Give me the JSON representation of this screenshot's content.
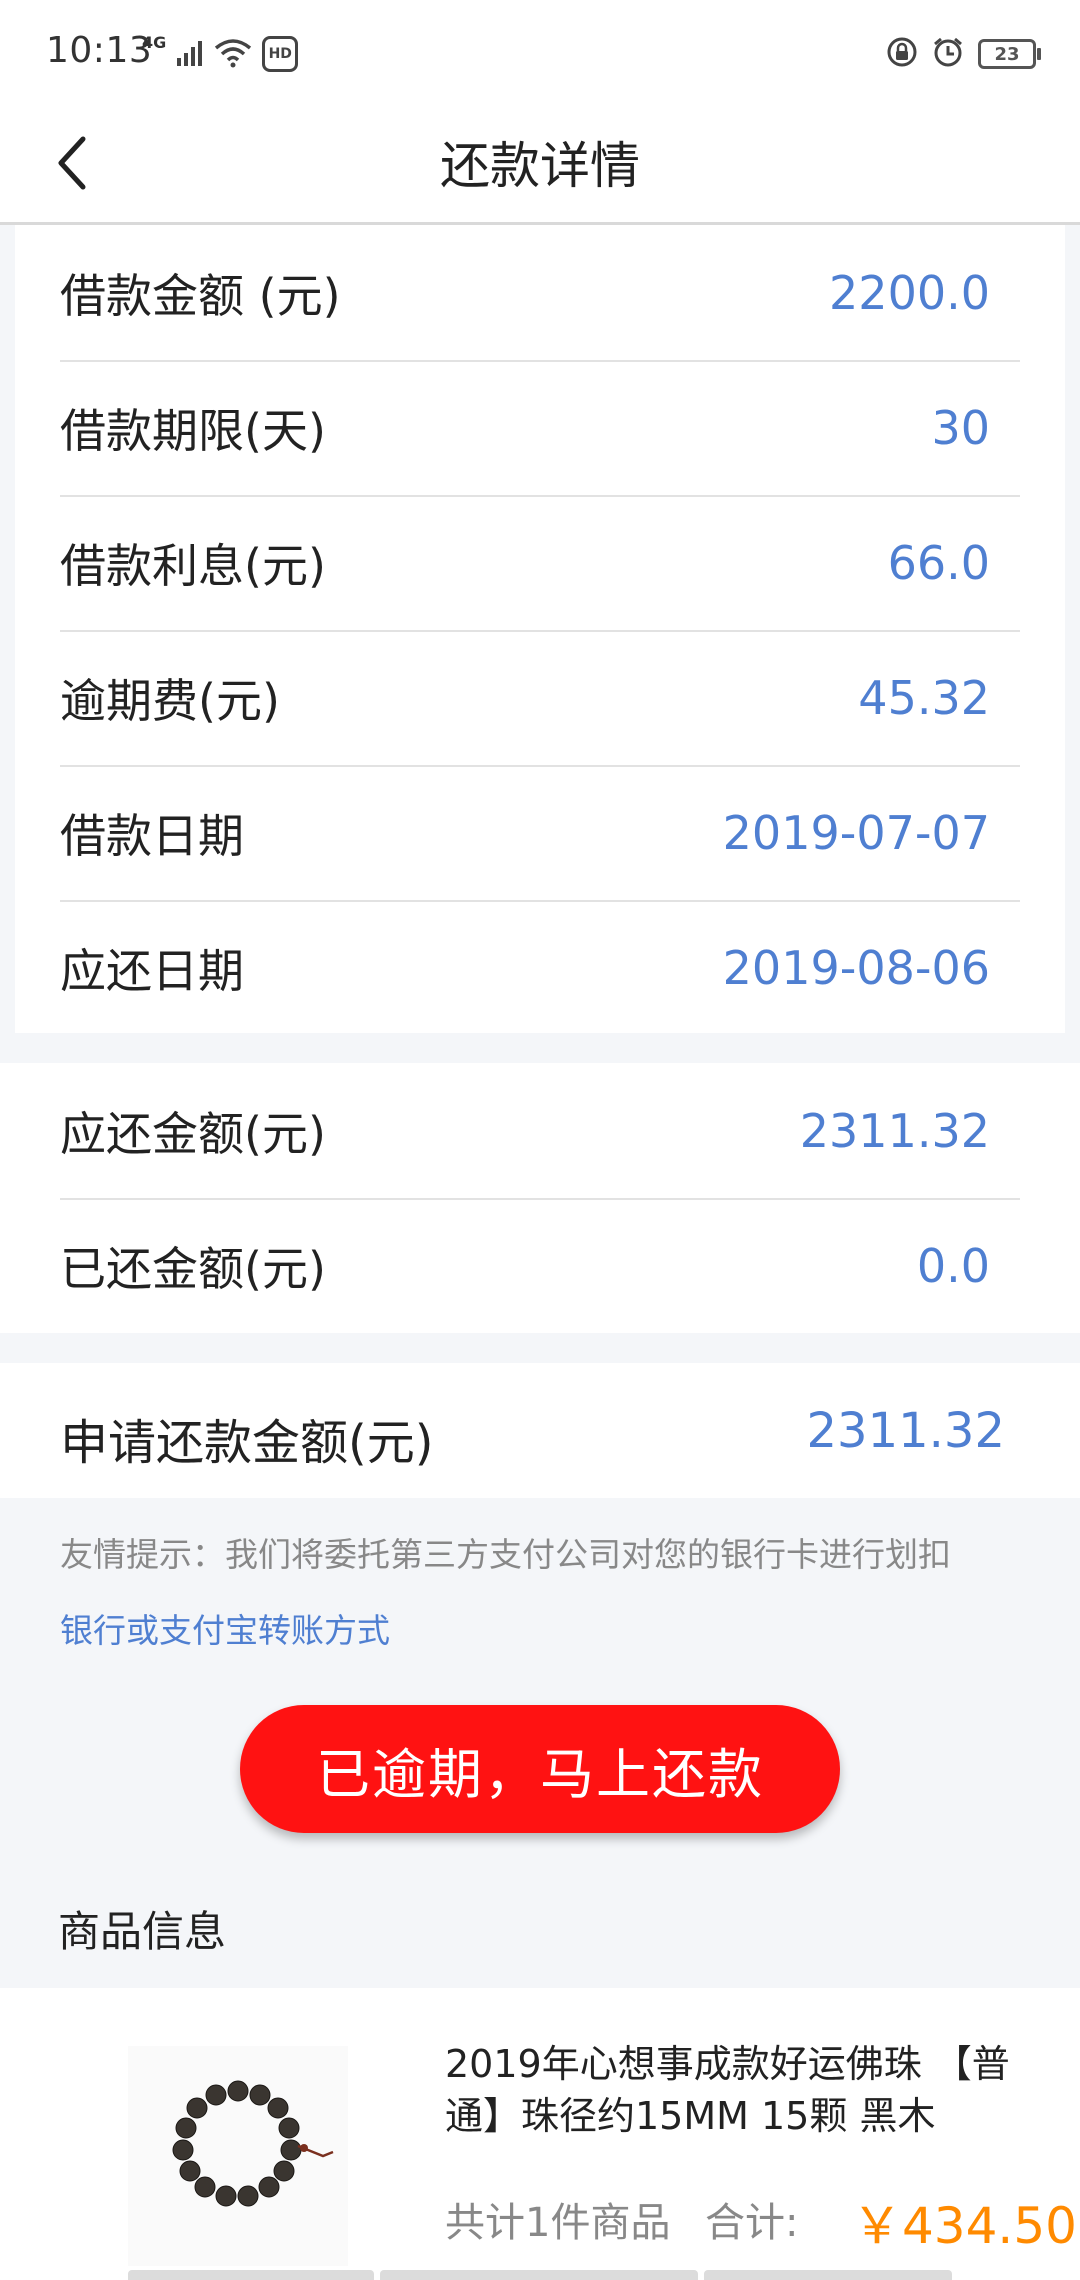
{
  "status_bar": {
    "time": "10:13",
    "network": "4G",
    "hd": "HD",
    "battery": "23"
  },
  "header": {
    "title": "还款详情"
  },
  "loan_details": [
    {
      "label": "借款金额 (元)",
      "value": "2200.0"
    },
    {
      "label": "借款期限(天)",
      "value": "30"
    },
    {
      "label": "借款利息(元)",
      "value": "66.0"
    },
    {
      "label": "逾期费(元)",
      "value": "45.32"
    },
    {
      "label": "借款日期",
      "value": "2019-07-07"
    },
    {
      "label": "应还日期",
      "value": "2019-08-06"
    }
  ],
  "repayment": [
    {
      "label": "应还金额(元)",
      "value": "2311.32"
    },
    {
      "label": "已还金额(元)",
      "value": "0.0"
    }
  ],
  "apply": {
    "label": "申请还款金额(元)",
    "value": "2311.32"
  },
  "tips": {
    "notice": "友情提示：我们将委托第三方支付公司对您的银行卡进行划扣",
    "link": "银行或支付宝转账方式"
  },
  "pay_button": {
    "label": "已逾期，马上还款"
  },
  "product_section": {
    "title": "商品信息",
    "name": "2019年心想事成款好运佛珠 【普通】珠径约15MM 15颗 黑木",
    "count_text": "共计1件商品",
    "total_label": "合计:",
    "price": "￥434.50"
  },
  "colors": {
    "accent_blue": "#4f7fd1",
    "button_red": "#ff1212",
    "price_orange": "#ff8a00"
  }
}
